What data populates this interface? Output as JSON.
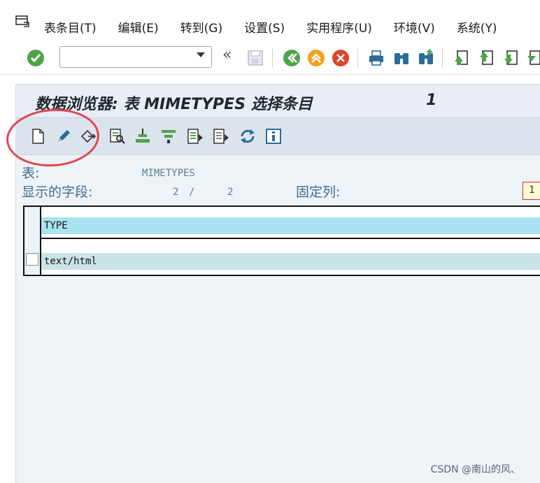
{
  "menu": {
    "items": [
      "表条目(T)",
      "编辑(E)",
      "转到(G)",
      "设置(S)",
      "实用程序(U)",
      "环境(V)",
      "系统(Y)"
    ]
  },
  "toolbar": {
    "command_field_value": "",
    "icons": [
      "check-icon",
      "back-icon",
      "save-icon",
      "exit-icon",
      "up-icon",
      "cancel-icon",
      "print-icon",
      "find-icon",
      "find-next-icon",
      "first-page-icon",
      "previous-page-icon",
      "next-page-icon",
      "last-page-icon"
    ],
    "back_glyph": "«"
  },
  "screen": {
    "title": "数据浏览器: 表 MIMETYPES 选择条目",
    "count": "1"
  },
  "app_toolbar": {
    "icons": [
      "create-icon",
      "change-icon",
      "check-table-icon",
      "details-icon",
      "sort-ascending-icon",
      "filter-icon",
      "select-layout-icon",
      "choose-fields-icon",
      "refresh-icon",
      "info-icon"
    ]
  },
  "info": {
    "table_label": "表:",
    "table_value": "MIMETYPES",
    "fields_label": "显示的字段:",
    "fields_shown": "2",
    "fields_sep": "/",
    "fields_total": "2",
    "fixed_label": "固定列:",
    "fixed_value": "1"
  },
  "grid": {
    "columns": [
      "TYPE"
    ],
    "rows": [
      [
        "text/html"
      ]
    ]
  },
  "watermark": "CSDN @南山的风、",
  "colors": {
    "accent_green": "#4ea34a",
    "accent_orange": "#f3a21c",
    "accent_red": "#d9472b",
    "header_cell": "#a9e3f1",
    "row_cell": "#c9e4e4",
    "highlight_circle": "#e0474c"
  }
}
